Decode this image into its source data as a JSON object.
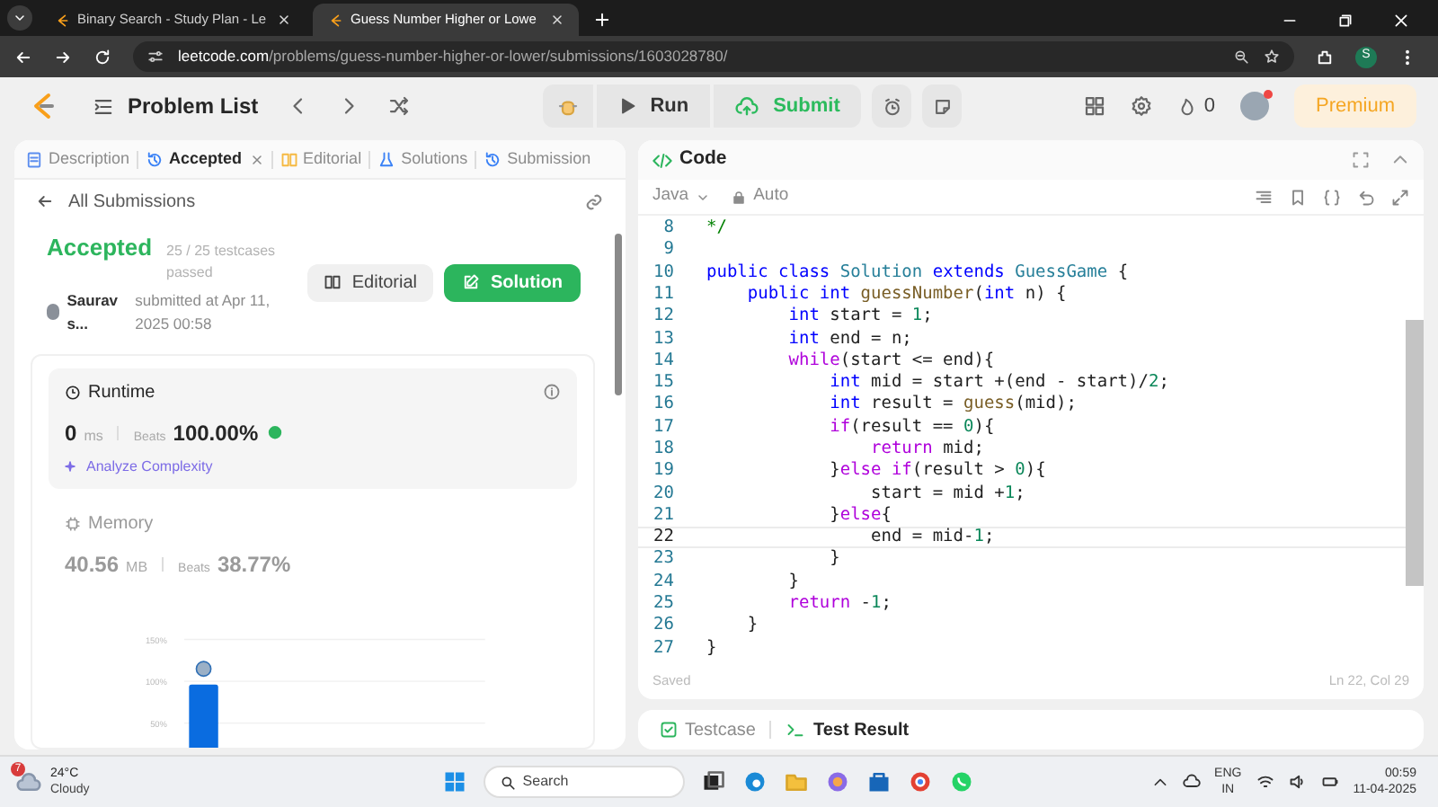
{
  "browser": {
    "tabs": [
      {
        "title": "Binary Search - Study Plan - Le",
        "selected": false
      },
      {
        "title": "Guess Number Higher or Lowe",
        "selected": true
      }
    ],
    "url_domain": "leetcode.com",
    "url_path": "/problems/guess-number-higher-or-lower/submissions/1603028780/",
    "profile_initial": "S"
  },
  "nav": {
    "problem_list": "Problem List",
    "run": "Run",
    "submit": "Submit",
    "streak": "0",
    "premium": "Premium"
  },
  "left_panel": {
    "tabs": [
      {
        "label": "Description",
        "selected": false,
        "closable": false
      },
      {
        "label": "Accepted",
        "selected": true,
        "closable": true
      },
      {
        "label": "Editorial",
        "selected": false,
        "closable": false
      },
      {
        "label": "Solutions",
        "selected": false,
        "closable": false
      },
      {
        "label": "Submission",
        "selected": false,
        "closable": false
      }
    ],
    "back_link": "All Submissions",
    "status": "Accepted",
    "testcases": "25 / 25 testcases passed",
    "user": "Saurav s...",
    "submitted": "submitted at Apr 11, 2025 00:58",
    "buttons": [
      "Editorial",
      "Solution"
    ],
    "metrics": [
      {
        "kind": "runtime",
        "title": "Runtime",
        "value": "0",
        "unit": "ms",
        "beats_label": "Beats",
        "beats": "100.00%",
        "link": "Analyze Complexity",
        "selected": true
      },
      {
        "kind": "memory",
        "title": "Memory",
        "value": "40.56",
        "unit": "MB",
        "beats_label": "Beats",
        "beats": "38.77%",
        "selected": false,
        "chart_data": {
          "type": "bar",
          "values": [
            96
          ],
          "ylim": [
            0,
            150
          ],
          "yticks": [
            {
              "value": 50,
              "label": "50%"
            },
            {
              "value": 100,
              "label": "100%"
            },
            {
              "value": 150,
              "label": "150%"
            }
          ]
        }
      }
    ]
  },
  "code_panel": {
    "title": "Code",
    "language": "Java",
    "mode": "Auto",
    "lines": [
      {
        "number": "8",
        "active": false,
        "tokens": [
          {
            "text": "*/",
            "kind": "comment"
          }
        ]
      },
      {
        "number": "9",
        "active": false
      },
      {
        "number": "10",
        "active": false,
        "tokens": [
          {
            "text": "public class ",
            "kind": "keyword"
          },
          {
            "text": "Solution ",
            "kind": "type"
          },
          {
            "text": "extends ",
            "kind": "keyword"
          },
          {
            "text": "GuessGame",
            "kind": "type"
          },
          {
            "text": " {",
            "kind": "plain"
          }
        ]
      },
      {
        "number": "11",
        "active": false,
        "tokens": [
          {
            "text": "    public int ",
            "kind": "keyword"
          },
          {
            "text": "guessNumber",
            "kind": "function"
          },
          {
            "text": "(",
            "kind": "plain"
          },
          {
            "text": "int",
            "kind": "keyword"
          },
          {
            "text": " n) {",
            "kind": "plain"
          }
        ]
      },
      {
        "number": "12",
        "active": false,
        "tokens": [
          {
            "text": "        int",
            "kind": "keyword"
          },
          {
            "text": " start = ",
            "kind": "plain"
          },
          {
            "text": "1",
            "kind": "number"
          },
          {
            "text": ";",
            "kind": "plain"
          }
        ]
      },
      {
        "number": "13",
        "active": false,
        "tokens": [
          {
            "text": "        int",
            "kind": "keyword"
          },
          {
            "text": " end = n;",
            "kind": "plain"
          }
        ]
      },
      {
        "number": "14",
        "active": false,
        "tokens": [
          {
            "text": "        while",
            "kind": "control"
          },
          {
            "text": "(start <= end){",
            "kind": "plain"
          }
        ]
      },
      {
        "number": "15",
        "active": false,
        "tokens": [
          {
            "text": "            int",
            "kind": "keyword"
          },
          {
            "text": " mid = start +(end - start)/",
            "kind": "plain"
          },
          {
            "text": "2",
            "kind": "number"
          },
          {
            "text": ";",
            "kind": "plain"
          }
        ]
      },
      {
        "number": "16",
        "active": false,
        "tokens": [
          {
            "text": "            int",
            "kind": "keyword"
          },
          {
            "text": " result = ",
            "kind": "plain"
          },
          {
            "text": "guess",
            "kind": "function"
          },
          {
            "text": "(mid);",
            "kind": "plain"
          }
        ]
      },
      {
        "number": "17",
        "active": false,
        "tokens": [
          {
            "text": "            if",
            "kind": "control"
          },
          {
            "text": "(result == ",
            "kind": "plain"
          },
          {
            "text": "0",
            "kind": "number"
          },
          {
            "text": "){",
            "kind": "plain"
          }
        ]
      },
      {
        "number": "18",
        "active": false,
        "tokens": [
          {
            "text": "                return",
            "kind": "control"
          },
          {
            "text": " mid;",
            "kind": "plain"
          }
        ]
      },
      {
        "number": "19",
        "active": false,
        "tokens": [
          {
            "text": "            }",
            "kind": "plain"
          },
          {
            "text": "else if",
            "kind": "control"
          },
          {
            "text": "(result > ",
            "kind": "plain"
          },
          {
            "text": "0",
            "kind": "number"
          },
          {
            "text": "){",
            "kind": "plain"
          }
        ]
      },
      {
        "number": "20",
        "active": false,
        "tokens": [
          {
            "text": "                start = mid +",
            "kind": "plain"
          },
          {
            "text": "1",
            "kind": "number"
          },
          {
            "text": ";",
            "kind": "plain"
          }
        ]
      },
      {
        "number": "21",
        "active": false,
        "tokens": [
          {
            "text": "            }",
            "kind": "plain"
          },
          {
            "text": "else",
            "kind": "control"
          },
          {
            "text": "{",
            "kind": "plain"
          }
        ]
      },
      {
        "number": "22",
        "active": true,
        "tokens": [
          {
            "text": "                end = mid-",
            "kind": "plain"
          },
          {
            "text": "1",
            "kind": "number"
          },
          {
            "text": ";",
            "kind": "plain"
          }
        ]
      },
      {
        "number": "23",
        "active": false,
        "tokens": [
          {
            "text": "            }",
            "kind": "plain"
          }
        ]
      },
      {
        "number": "24",
        "active": false,
        "tokens": [
          {
            "text": "        }",
            "kind": "plain"
          }
        ]
      },
      {
        "number": "25",
        "active": false,
        "tokens": [
          {
            "text": "        return",
            "kind": "control"
          },
          {
            "text": " -",
            "kind": "plain"
          },
          {
            "text": "1",
            "kind": "number"
          },
          {
            "text": ";",
            "kind": "plain"
          }
        ]
      },
      {
        "number": "26",
        "active": false,
        "tokens": [
          {
            "text": "    }",
            "kind": "plain"
          }
        ]
      },
      {
        "number": "27",
        "active": false,
        "tokens": [
          {
            "text": "}",
            "kind": "plain"
          }
        ]
      }
    ],
    "saved": "Saved",
    "cursor": "Ln 22, Col 29"
  },
  "bottom_panel": {
    "tabs": [
      {
        "label": "Testcase",
        "selected": false
      },
      {
        "label": "Test Result",
        "selected": true
      }
    ]
  },
  "taskbar": {
    "weather_badge": "7",
    "temperature": "24°C",
    "weather": "Cloudy",
    "search": "Search",
    "language": "ENG",
    "region": "IN",
    "time": "00:59",
    "date": "11-04-2025"
  }
}
